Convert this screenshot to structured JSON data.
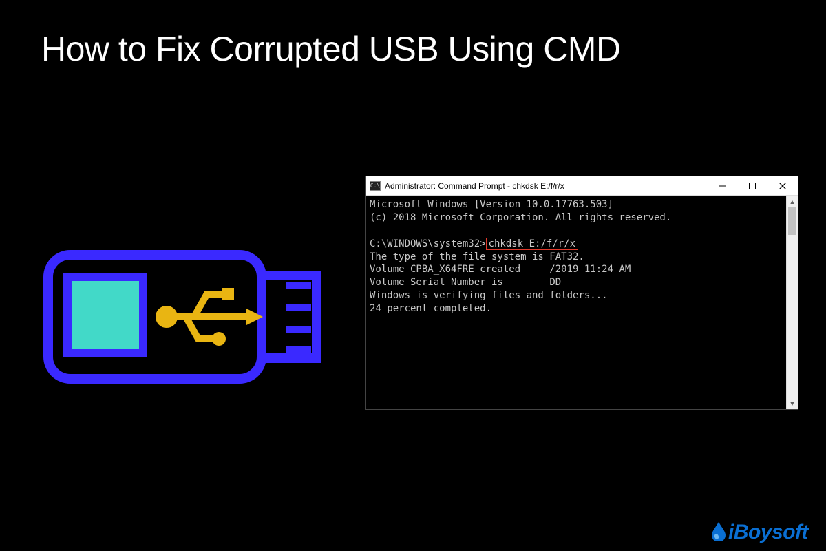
{
  "title": "How to Fix Corrupted USB Using CMD",
  "cmd": {
    "window_title": "Administrator: Command Prompt - chkdsk  E:/f/r/x",
    "line1": "Microsoft Windows [Version 10.0.17763.503]",
    "line2": "(c) 2018 Microsoft Corporation. All rights reserved.",
    "prompt": "C:\\WINDOWS\\system32>",
    "highlighted_command": "chkdsk E:/f/r/x",
    "out1": "The type of the file system is FAT32.",
    "out2a": "Volume CPBA_X64FRE created ",
    "out2b": "/2019 11:24 AM",
    "out3a": "Volume Serial Number is ",
    "out3b": "DD",
    "out4": "Windows is verifying files and folders...",
    "out5": "24 percent completed."
  },
  "logo": {
    "text": "iBoysoft"
  },
  "colors": {
    "usb_outline": "#3a29ff",
    "usb_screen": "#42d9c8",
    "usb_symbol": "#e9b512",
    "highlight_border": "#e13a2b",
    "logo_color": "#0a6fd3"
  }
}
